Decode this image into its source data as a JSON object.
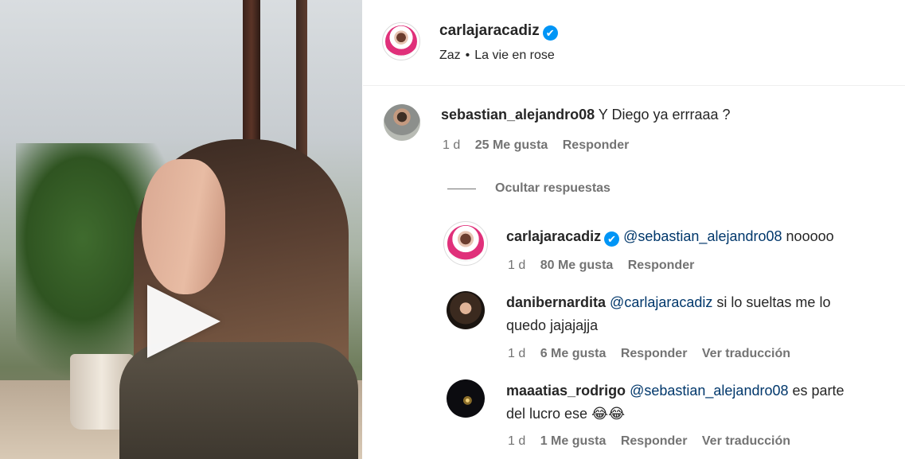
{
  "post": {
    "author": "carlajaracadiz",
    "verified_mark": "✔",
    "music_artist": "Zaz",
    "music_separator": "•",
    "music_title": "La vie en rose"
  },
  "comments": [
    {
      "username": "sebastian_alejandro08",
      "text": "Y Diego ya errraaa ?",
      "time": "1 d",
      "likes": "25 Me gusta",
      "reply": "Responder"
    }
  ],
  "hide_replies_label": "Ocultar respuestas",
  "replies": [
    {
      "username": "carlajaracadiz",
      "verified_mark": "✔",
      "mention": "@sebastian_alejandro08",
      "text": "nooooo",
      "time": "1 d",
      "likes": "80 Me gusta",
      "reply": "Responder"
    },
    {
      "username": "danibernardita",
      "mention": "@carlajaracadiz",
      "text_line1": "si lo sueltas me lo",
      "text_line2": "quedo jajajajja",
      "time": "1 d",
      "likes": "6 Me gusta",
      "reply": "Responder",
      "translate": "Ver traducción"
    },
    {
      "username": "maaatias_rodrigo",
      "mention": "@sebastian_alejandro08",
      "text_line1": "es parte",
      "text_line2": "del lucro ese 😂😂",
      "time": "1 d",
      "likes": "1 Me gusta",
      "reply": "Responder",
      "translate": "Ver traducción"
    }
  ],
  "colors": {
    "link_blue": "#00376b",
    "verified_blue": "#0095f6",
    "meta_gray": "#737373"
  },
  "icons": {
    "play": "play-icon",
    "verified": "verified-badge-icon"
  }
}
